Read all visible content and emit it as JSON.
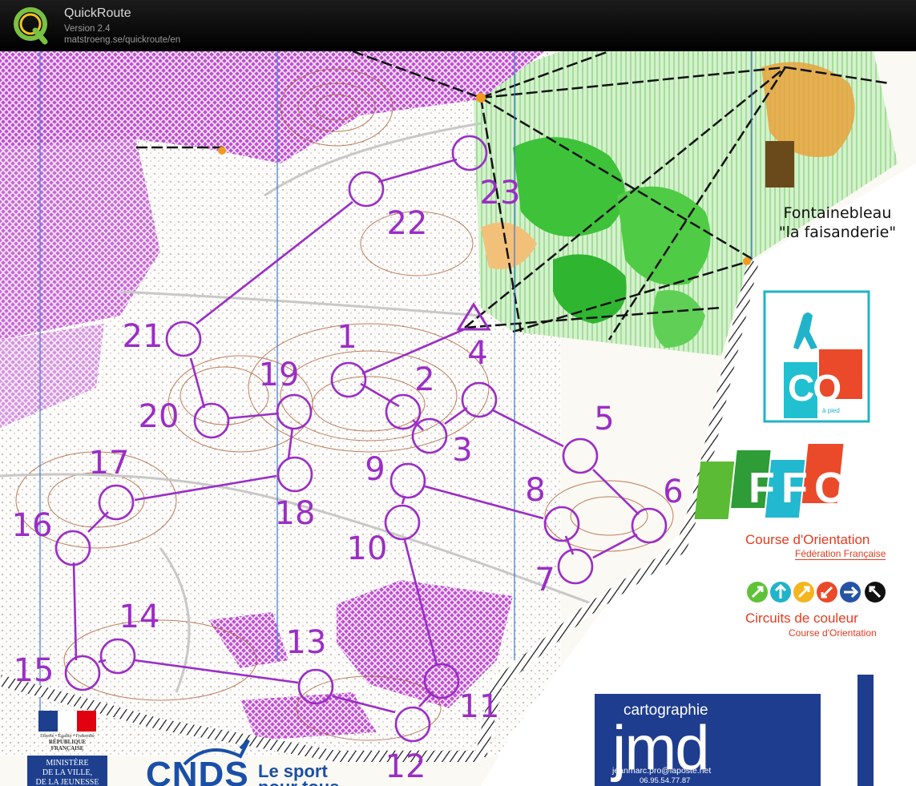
{
  "app": {
    "name": "QuickRoute",
    "version": "Version 2.4",
    "url": "matstroeng.se/quickroute/en"
  },
  "map": {
    "place_line1": "Fontainebleau",
    "place_line2": "\"la faisanderie\"",
    "route_color": "#9b2dc6",
    "controls": [
      {
        "num": "1",
        "label": "1"
      },
      {
        "num": "2",
        "label": "2"
      },
      {
        "num": "3",
        "label": "3"
      },
      {
        "num": "4",
        "label": "4"
      },
      {
        "num": "5",
        "label": "5"
      },
      {
        "num": "6",
        "label": "6"
      },
      {
        "num": "7",
        "label": "7"
      },
      {
        "num": "8",
        "label": "8"
      },
      {
        "num": "9",
        "label": "9"
      },
      {
        "num": "10",
        "label": "10"
      },
      {
        "num": "11",
        "label": "11"
      },
      {
        "num": "12",
        "label": "12"
      },
      {
        "num": "13",
        "label": "13"
      },
      {
        "num": "14",
        "label": "14"
      },
      {
        "num": "15",
        "label": "15"
      },
      {
        "num": "16",
        "label": "16"
      },
      {
        "num": "17",
        "label": "17"
      },
      {
        "num": "18",
        "label": "18"
      },
      {
        "num": "19",
        "label": "19"
      },
      {
        "num": "20",
        "label": "20"
      },
      {
        "num": "21",
        "label": "21"
      },
      {
        "num": "22",
        "label": "22"
      },
      {
        "num": "23",
        "label": "23"
      }
    ]
  },
  "logos": {
    "co_text": "CO",
    "co_sub": "à pied",
    "ffco_text": "FFCO",
    "ffco_line1": "Course d'Orientation",
    "ffco_line2": "Fédération Française",
    "circuits_line1": "Circuits de couleur",
    "circuits_line2": "Course d'Orientation",
    "jmd_line1": "cartographie",
    "jmd_line2": "jmd",
    "jmd_email": "jeanmarc.pro@laposte.net",
    "jmd_phone": "06.95.54.77.87",
    "cnds_text": "CNDS",
    "cnds_slogan1": "Le sport",
    "cnds_slogan2": "pour tous",
    "rf_motto": "Liberté • Égalité • Fraternité",
    "rf_name": "RÉPUBLIQUE FRANÇAISE",
    "ministry_line1": "MINISTÈRE",
    "ministry_line2": "DE LA VILLE,",
    "ministry_line3": "DE LA JEUNESSE"
  }
}
